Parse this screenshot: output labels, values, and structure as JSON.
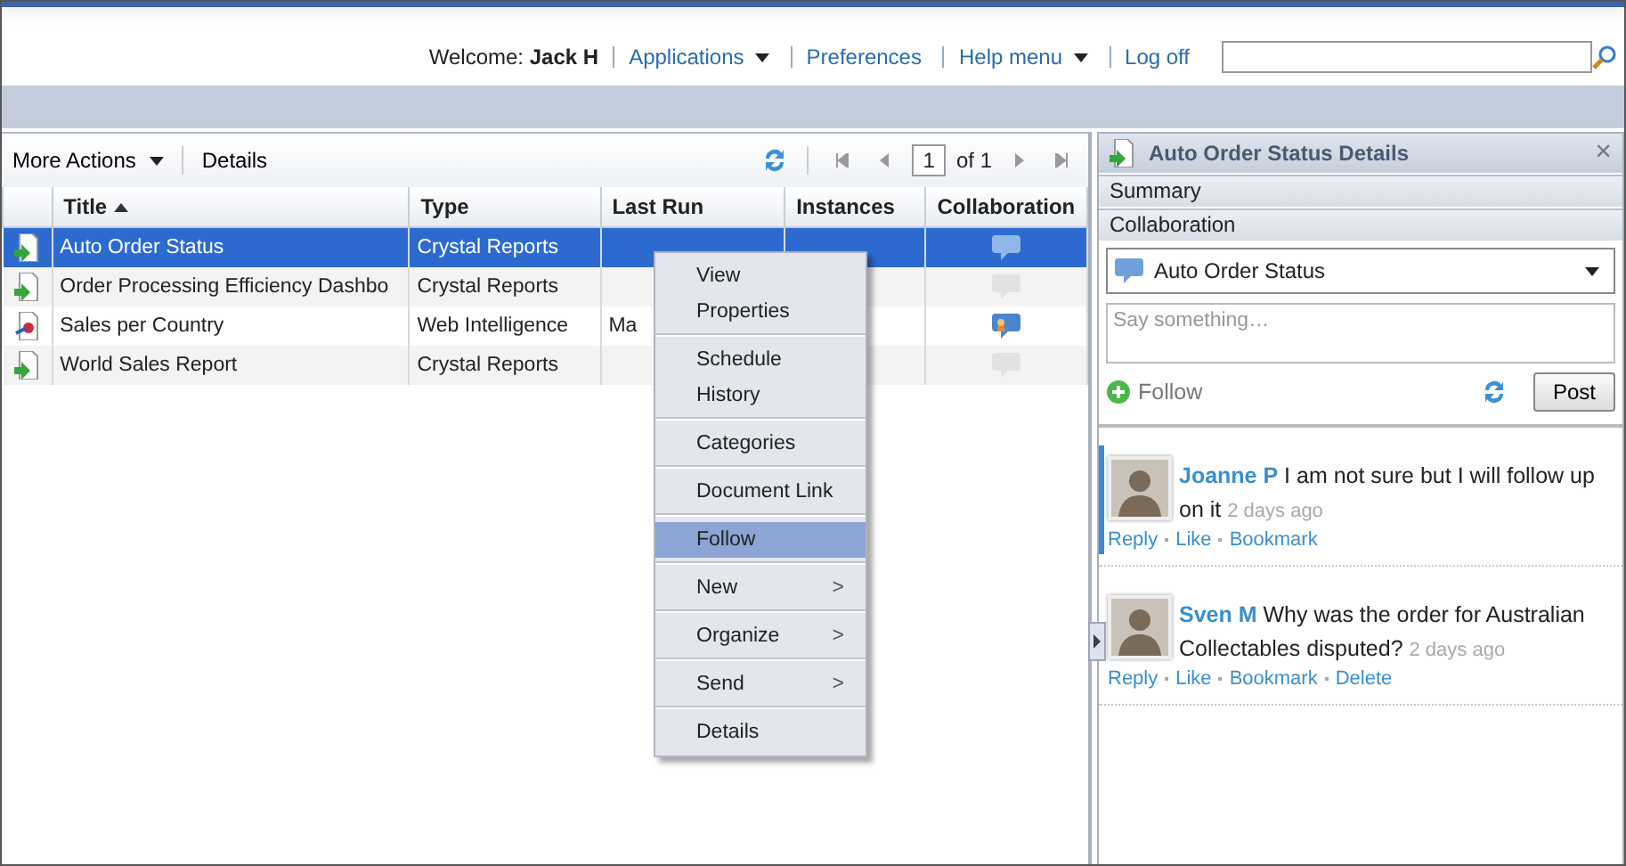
{
  "header": {
    "welcome_label": "Welcome:",
    "user": "Jack H",
    "links": [
      {
        "label": "Applications",
        "dropdown": true
      },
      {
        "label": "Preferences",
        "dropdown": false
      },
      {
        "label": "Help menu",
        "dropdown": true
      },
      {
        "label": "Log off",
        "dropdown": false
      }
    ]
  },
  "toolbar": {
    "more_actions": "More Actions",
    "details": "Details",
    "page": "1",
    "page_of": "of 1"
  },
  "table": {
    "columns": [
      {
        "label": "Title",
        "sorted": true
      },
      {
        "label": "Type",
        "sorted": false
      },
      {
        "label": "Last Run",
        "sorted": false
      },
      {
        "label": "Instances",
        "sorted": false
      },
      {
        "label": "Collaboration",
        "sorted": false
      }
    ],
    "rows": [
      {
        "kind": "crystal",
        "title": "Auto Order Status",
        "type": "Crystal Reports",
        "last_run": "",
        "collaboration": {
          "kind": "active"
        },
        "selected": true
      },
      {
        "kind": "crystal",
        "title": "Order Processing Efficiency Dashbo",
        "type": "Crystal Reports",
        "last_run": "",
        "collaboration": {
          "kind": "empty"
        },
        "selected": false
      },
      {
        "kind": "webi",
        "title": "Sales per Country",
        "type": "Web Intelligence",
        "last_run": "Ma",
        "collaboration": {
          "kind": "user"
        },
        "selected": false
      },
      {
        "kind": "crystal",
        "title": "World Sales Report",
        "type": "Crystal Reports",
        "last_run": "",
        "collaboration": {
          "kind": "empty"
        },
        "selected": false
      }
    ]
  },
  "context_menu": {
    "groups": [
      [
        {
          "label": "View",
          "submenu": false,
          "selected": false
        },
        {
          "label": "Properties",
          "submenu": false,
          "selected": false
        }
      ],
      [
        {
          "label": "Schedule",
          "submenu": false,
          "selected": false
        },
        {
          "label": "History",
          "submenu": false,
          "selected": false
        }
      ],
      [
        {
          "label": "Categories",
          "submenu": false,
          "selected": false
        }
      ],
      [
        {
          "label": "Document Link",
          "submenu": false,
          "selected": false
        }
      ],
      [
        {
          "label": "Follow",
          "submenu": false,
          "selected": true
        }
      ],
      [
        {
          "label": "New",
          "submenu": true,
          "selected": false
        }
      ],
      [
        {
          "label": "Organize",
          "submenu": true,
          "selected": false
        }
      ],
      [
        {
          "label": "Send",
          "submenu": true,
          "selected": false
        }
      ],
      [
        {
          "label": "Details",
          "submenu": false,
          "selected": false
        }
      ]
    ],
    "submenu_arrow": ">"
  },
  "details_panel": {
    "title": "Auto Order Status Details",
    "close": "×",
    "sections": [
      "Summary",
      "Collaboration"
    ],
    "topic": "Auto Order Status",
    "comment_placeholder": "Say something…",
    "follow": "Follow",
    "post": "Post",
    "comments": [
      {
        "author": "Joanne P",
        "text": "I am not sure but I will follow up on it",
        "time": "2 days ago",
        "actions": [
          "Reply",
          "Like",
          "Bookmark"
        ],
        "highlighted": true
      },
      {
        "author": "Sven M",
        "text": "Why was the order for Australian Collectables disputed?",
        "time": "2 days ago",
        "actions": [
          "Reply",
          "Like",
          "Bookmark",
          "Delete"
        ],
        "highlighted": false
      }
    ]
  }
}
